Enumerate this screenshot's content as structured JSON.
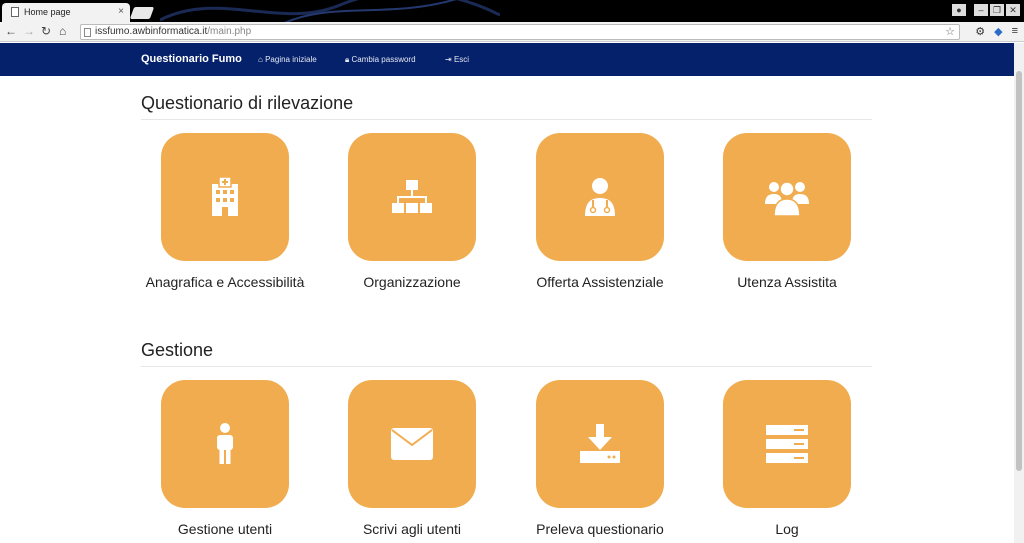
{
  "browser": {
    "tab_title": "Home page",
    "tab_close": "×",
    "url_host": "issfumo.awbinformatica.it",
    "url_path": "/main.php"
  },
  "navbar": {
    "brand": "Questionario Fumo",
    "links": [
      {
        "label": "Pagina iniziale",
        "icon": "home-icon"
      },
      {
        "label": "Cambia password",
        "icon": "lock-icon"
      },
      {
        "label": "Esci",
        "icon": "sign-out-icon"
      }
    ]
  },
  "sections": [
    {
      "title": "Questionario di rilevazione",
      "tiles": [
        {
          "label": "Anagrafica e Accessibilità",
          "icon": "hospital-icon"
        },
        {
          "label": "Organizzazione",
          "icon": "org-chart-icon"
        },
        {
          "label": "Offerta Assistenziale",
          "icon": "doctor-icon"
        },
        {
          "label": "Utenza Assistita",
          "icon": "users-icon"
        }
      ]
    },
    {
      "title": "Gestione",
      "tiles": [
        {
          "label": "Gestione utenti",
          "icon": "person-icon"
        },
        {
          "label": "Scrivi agli utenti",
          "icon": "envelope-icon"
        },
        {
          "label": "Preleva questionario",
          "icon": "download-icon"
        },
        {
          "label": "Log",
          "icon": "server-icon"
        }
      ]
    }
  ],
  "colors": {
    "navbar": "#05216b",
    "tile": "#f0ac4e"
  }
}
